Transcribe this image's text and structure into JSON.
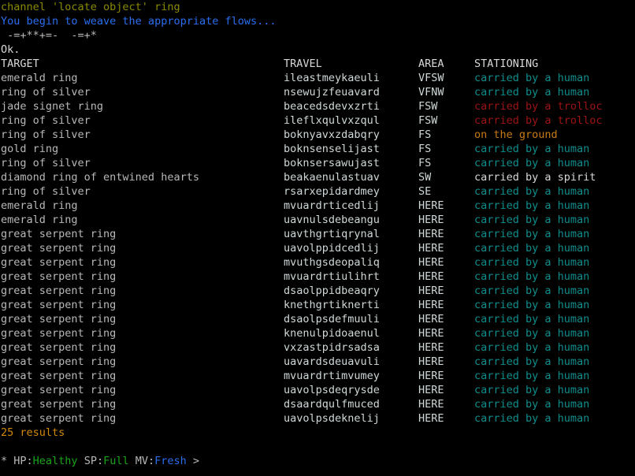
{
  "terminal": {
    "background": "#000000",
    "default_text_color": "#c8c8c8"
  },
  "colors": {
    "command_echo": "#8a8a00",
    "message": "#2a6ef0",
    "weave": "#b8b8b8",
    "ok": "#d8d8d8",
    "header": "#d8d8d8",
    "carried_human": "#0f8d8d",
    "carried_trolloc": "#9e1414",
    "on_ground": "#c97a14",
    "carried_spirit": "#d8d8d8",
    "results_count": "#d2890c",
    "prompt_hp": "#1aa41a",
    "prompt_sp": "#1aa41a",
    "prompt_mv": "#2a6ef0"
  },
  "scrollback": {
    "command_echo": "channel 'locate object' ring",
    "weave_message": "You begin to weave the appropriate flows...",
    "weave_progress": " -=+**+=-  -=+*",
    "ok": "Ok."
  },
  "table": {
    "headers": {
      "target": "TARGET",
      "travel": "TRAVEL",
      "area": "AREA",
      "stationing": "STATIONING"
    },
    "rows": [
      {
        "target": "emerald ring",
        "travel": "ileastmeykaeuli",
        "area": "VFSW",
        "stationing": "carried by a human",
        "station_style": "c-teal"
      },
      {
        "target": "ring of silver",
        "travel": "nsewujzfeuavard",
        "area": "VFNW",
        "stationing": "carried by a human",
        "station_style": "c-teal"
      },
      {
        "target": "jade signet ring",
        "travel": "beacedsdevxzrti",
        "area": "FSW",
        "stationing": "carried by a trolloc",
        "station_style": "c-darkred"
      },
      {
        "target": "ring of silver",
        "travel": "ileflxqulvxzqul",
        "area": "FSW",
        "stationing": "carried by a trolloc",
        "station_style": "c-darkred"
      },
      {
        "target": "ring of silver",
        "travel": "boknyavxzdabqry",
        "area": "FS",
        "stationing": "on the ground",
        "station_style": "c-orange"
      },
      {
        "target": "gold ring",
        "travel": "boknsenselijast",
        "area": "FS",
        "stationing": "carried by a human",
        "station_style": "c-teal"
      },
      {
        "target": "ring of silver",
        "travel": "boknsersawujast",
        "area": "FS",
        "stationing": "carried by a human",
        "station_style": "c-teal"
      },
      {
        "target": "diamond ring of entwined hearts",
        "travel": "beakaenulastuav",
        "area": "SW",
        "stationing": "carried by a spirit",
        "station_style": "c-white"
      },
      {
        "target": "ring of silver",
        "travel": "rsarxepidardmey",
        "area": "SE",
        "stationing": "carried by a human",
        "station_style": "c-teal"
      },
      {
        "target": "emerald ring",
        "travel": "mvuardrticedlij",
        "area": "HERE",
        "stationing": "carried by a human",
        "station_style": "c-teal"
      },
      {
        "target": "emerald ring",
        "travel": "uavnulsdebeangu",
        "area": "HERE",
        "stationing": "carried by a human",
        "station_style": "c-teal"
      },
      {
        "target": "great serpent ring",
        "travel": "uavthgrtiqrynal",
        "area": "HERE",
        "stationing": "carried by a human",
        "station_style": "c-teal"
      },
      {
        "target": "great serpent ring",
        "travel": "uavolppidcedlij",
        "area": "HERE",
        "stationing": "carried by a human",
        "station_style": "c-teal"
      },
      {
        "target": "great serpent ring",
        "travel": "mvuthgsdeopaliq",
        "area": "HERE",
        "stationing": "carried by a human",
        "station_style": "c-teal"
      },
      {
        "target": "great serpent ring",
        "travel": "mvuardrtiulihrt",
        "area": "HERE",
        "stationing": "carried by a human",
        "station_style": "c-teal"
      },
      {
        "target": "great serpent ring",
        "travel": "dsaolppidbeaqry",
        "area": "HERE",
        "stationing": "carried by a human",
        "station_style": "c-teal"
      },
      {
        "target": "great serpent ring",
        "travel": "knethgrtiknerti",
        "area": "HERE",
        "stationing": "carried by a human",
        "station_style": "c-teal"
      },
      {
        "target": "great serpent ring",
        "travel": "dsaolpsdefmuuli",
        "area": "HERE",
        "stationing": "carried by a human",
        "station_style": "c-teal"
      },
      {
        "target": "great serpent ring",
        "travel": "knenulpidoaenul",
        "area": "HERE",
        "stationing": "carried by a human",
        "station_style": "c-teal"
      },
      {
        "target": "great serpent ring",
        "travel": "vxzastpidrsadsa",
        "area": "HERE",
        "stationing": "carried by a human",
        "station_style": "c-teal"
      },
      {
        "target": "great serpent ring",
        "travel": "uavardsdeuavuli",
        "area": "HERE",
        "stationing": "carried by a human",
        "station_style": "c-teal"
      },
      {
        "target": "great serpent ring",
        "travel": "mvuardrtimvumey",
        "area": "HERE",
        "stationing": "carried by a human",
        "station_style": "c-teal"
      },
      {
        "target": "great serpent ring",
        "travel": "uavolpsdeqrysde",
        "area": "HERE",
        "stationing": "carried by a human",
        "station_style": "c-teal"
      },
      {
        "target": "great serpent ring",
        "travel": "dsaardqulfmuced",
        "area": "HERE",
        "stationing": "carried by a human",
        "station_style": "c-teal"
      },
      {
        "target": "great serpent ring",
        "travel": "uavolpsdeknelij",
        "area": "HERE",
        "stationing": "carried by a human",
        "station_style": "c-teal"
      }
    ],
    "results_line": "25 results"
  },
  "prompt": {
    "marker": "* ",
    "hp_label": "HP:",
    "hp_value": "Healthy",
    "sp_label": " SP:",
    "sp_value": "Full",
    "mv_label": " MV:",
    "mv_value": "Fresh",
    "caret": " >"
  }
}
